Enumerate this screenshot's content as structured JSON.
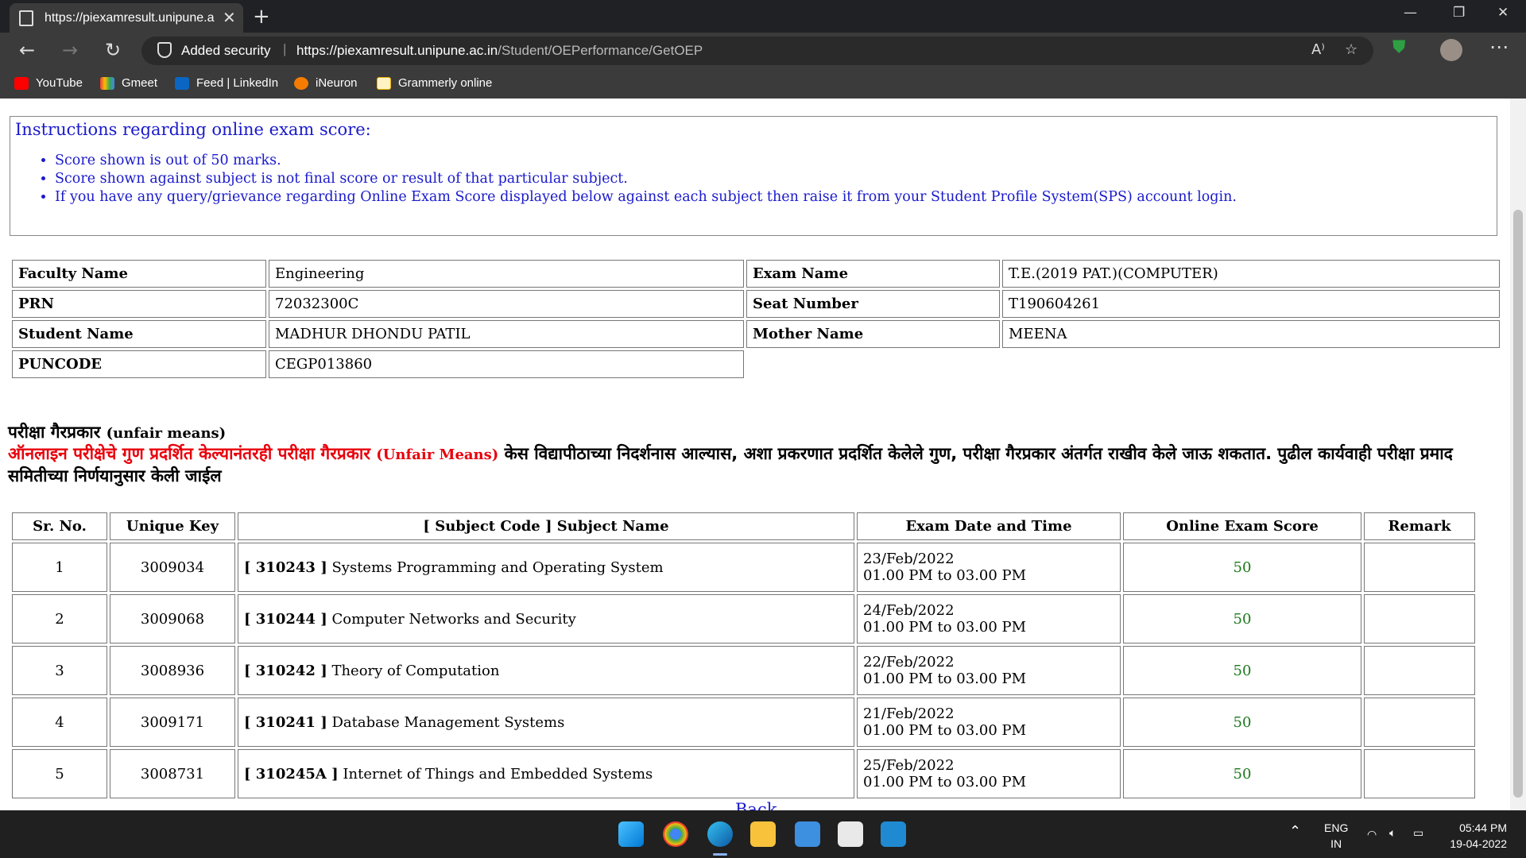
{
  "browser": {
    "tab_title": "https://piexamresult.unipune.ac.i",
    "security_label": "Added security",
    "url_host": "https://piexamresult.unipune.ac.in",
    "url_path": "/Student/OEPerformance/GetOEP",
    "bookmarks": [
      "YouTube",
      "Gmeet",
      "Feed | LinkedIn",
      "iNeuron",
      "Grammerly online"
    ]
  },
  "instructions": {
    "title": "Instructions regarding online exam score:",
    "items": [
      "Score shown is out of 50 marks.",
      "Score shown against subject is not final score or result of that particular subject.",
      "If you have any query/grievance regarding Online Exam Score displayed below against each subject then raise it from your Student Profile System(SPS) account login."
    ]
  },
  "student": {
    "faculty_label": "Faculty Name",
    "faculty": "Engineering",
    "exam_label": "Exam Name",
    "exam": "T.E.(2019 PAT.)(COMPUTER)",
    "prn_label": "PRN",
    "prn": "72032300C",
    "seat_label": "Seat Number",
    "seat": "T190604261",
    "name_label": "Student Name",
    "name": "MADHUR DHONDU PATIL",
    "mother_label": "Mother Name",
    "mother": "MEENA",
    "puncode_label": "PUNCODE",
    "puncode": "CEGP013860"
  },
  "notice": {
    "heading": "परीक्षा गैरप्रकार",
    "heading_en": "(unfair means)",
    "line_red": "ऑनलाइन परीक्षेचे गुण प्रदर्शित केल्यानंतरही परीक्षा गैरप्रकार",
    "line_red_en": "(Unfair Means)",
    "line_rest": "केस विद्यापीठाच्या निदर्शनास आल्यास, अशा प्रकरणात प्रदर्शित केलेले गुण, परीक्षा गैरप्रकार अंतर्गत राखीव केले जाऊ शकतात. पुढील कार्यवाही परीक्षा प्रमाद समितीच्या निर्णयानुसार केली जाईल"
  },
  "results": {
    "headers": [
      "Sr. No.",
      "Unique Key",
      "[ Subject Code ] Subject Name",
      "Exam Date and Time",
      "Online Exam Score",
      "Remark"
    ],
    "rows": [
      {
        "sr": "1",
        "key": "3009034",
        "code": "[ 310243 ]",
        "subject": "Systems Programming and Operating System",
        "date": "23/Feb/2022",
        "time": "01.00 PM to 03.00 PM",
        "score": "50",
        "remark": ""
      },
      {
        "sr": "2",
        "key": "3009068",
        "code": "[ 310244 ]",
        "subject": "Computer Networks and Security",
        "date": "24/Feb/2022",
        "time": "01.00 PM to 03.00 PM",
        "score": "50",
        "remark": ""
      },
      {
        "sr": "3",
        "key": "3008936",
        "code": "[ 310242 ]",
        "subject": "Theory of Computation",
        "date": "22/Feb/2022",
        "time": "01.00 PM to 03.00 PM",
        "score": "50",
        "remark": ""
      },
      {
        "sr": "4",
        "key": "3009171",
        "code": "[ 310241 ]",
        "subject": "Database Management Systems",
        "date": "21/Feb/2022",
        "time": "01.00 PM to 03.00 PM",
        "score": "50",
        "remark": ""
      },
      {
        "sr": "5",
        "key": "3008731",
        "code": "[ 310245A ]",
        "subject": "Internet of Things and Embedded Systems",
        "date": "25/Feb/2022",
        "time": "01.00 PM to 03.00 PM",
        "score": "50",
        "remark": ""
      }
    ]
  },
  "back_link": "Back",
  "taskbar": {
    "lang_top": "ENG",
    "lang_bottom": "IN",
    "time": "05:44 PM",
    "date": "19-04-2022"
  }
}
